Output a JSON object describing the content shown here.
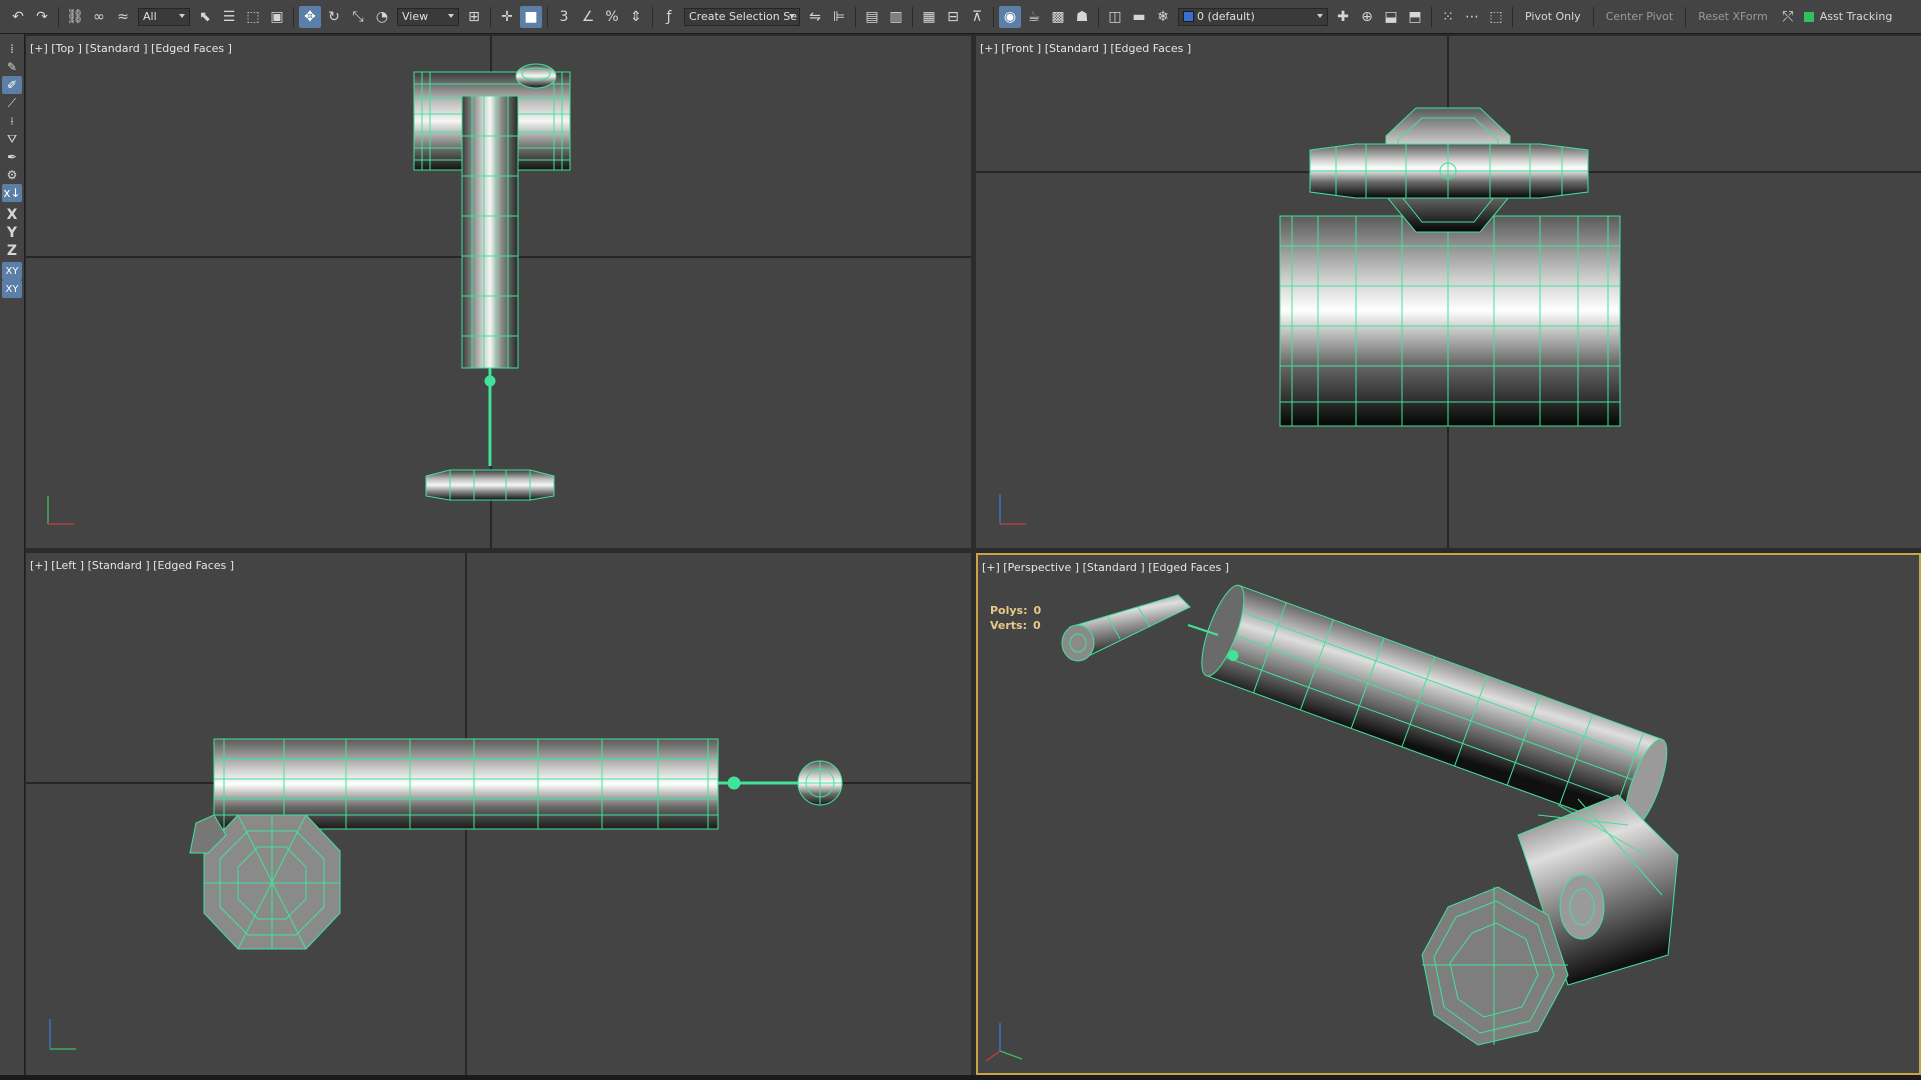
{
  "toolbar": {
    "selection_filter": "All",
    "reference_coord": "View",
    "named_selection": "Create Selection Se",
    "layer": "0 (default)",
    "pivot_only": "Pivot Only",
    "center_pivot": "Center Pivot",
    "reset_xform": "Reset XForm",
    "asst_tracking": "Asst Tracking"
  },
  "leftbar": {
    "x_label": "X",
    "y_label": "Y",
    "z_label": "Z",
    "xy_label": "XY",
    "xy2_label": "XY"
  },
  "viewports": {
    "top": {
      "label": "[+] [Top ] [Standard ] [Edged Faces ]"
    },
    "front": {
      "label": "[+] [Front ] [Standard ] [Edged Faces ]"
    },
    "left": {
      "label": "[+] [Left ] [Standard ] [Edged Faces ]"
    },
    "persp": {
      "label": "[+] [Perspective ] [Standard ] [Edged Faces ]",
      "polys_label": "Polys:",
      "polys_value": "0",
      "verts_label": "Verts:",
      "verts_value": "0"
    }
  },
  "colors": {
    "wire": "#41e39a",
    "viewport_bg": "#444444",
    "grid_line": "#1c1c1c",
    "active_border": "#c9a24a",
    "toolbar_bg": "#444444"
  }
}
